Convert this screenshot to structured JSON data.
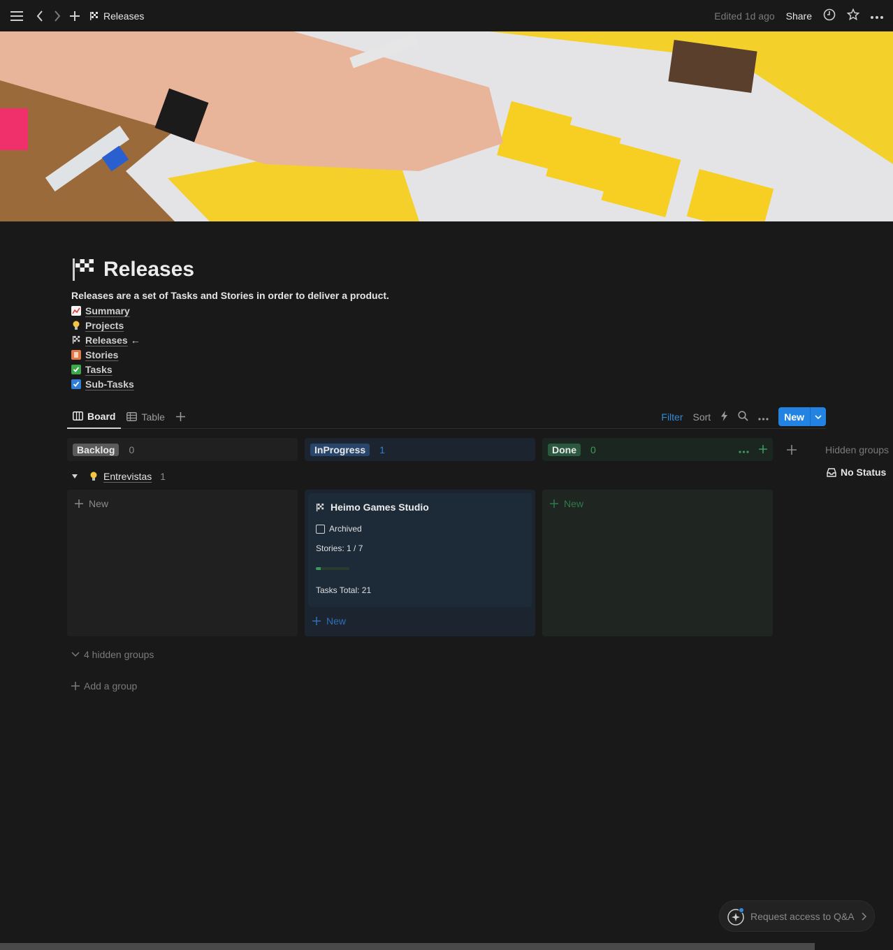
{
  "topbar": {
    "breadcrumb": "Releases",
    "edited": "Edited 1d ago",
    "share": "Share"
  },
  "page": {
    "title": "Releases",
    "description": "Releases are a set of Tasks and Stories in order to deliver a product.",
    "links": [
      {
        "label": "Summary",
        "icon": "chart-icon"
      },
      {
        "label": "Projects",
        "icon": "lightbulb-icon"
      },
      {
        "label": "Releases",
        "icon": "flag-icon",
        "suffix": "←"
      },
      {
        "label": "Stories",
        "icon": "book-icon"
      },
      {
        "label": "Tasks",
        "icon": "checkbox-icon"
      },
      {
        "label": "Sub-Tasks",
        "icon": "checkbox-blue-icon"
      }
    ]
  },
  "views": {
    "tabs": [
      {
        "label": "Board"
      },
      {
        "label": "Table"
      }
    ],
    "filter": "Filter",
    "sort": "Sort",
    "new": "New"
  },
  "board": {
    "columns": [
      {
        "label": "Backlog",
        "count": "0",
        "color": "#5a5a5a"
      },
      {
        "label": "InProgress",
        "count": "1",
        "color": "#28456c"
      },
      {
        "label": "Done",
        "count": "0",
        "color": "#2b593f"
      }
    ],
    "group": {
      "label": "Entrevistas",
      "count": "1"
    },
    "new_label": "New",
    "card": {
      "title": "Heimo Games Studio",
      "archived": "Archived",
      "stories": "Stories: 1 / 7",
      "progress": 0.14,
      "tasks": "Tasks Total: 21"
    },
    "hidden_groups_side": "Hidden groups",
    "no_status": "No Status",
    "hidden_groups": "4 hidden groups",
    "add_group": "Add a group"
  },
  "qa": {
    "label": "Request access to Q&A"
  }
}
